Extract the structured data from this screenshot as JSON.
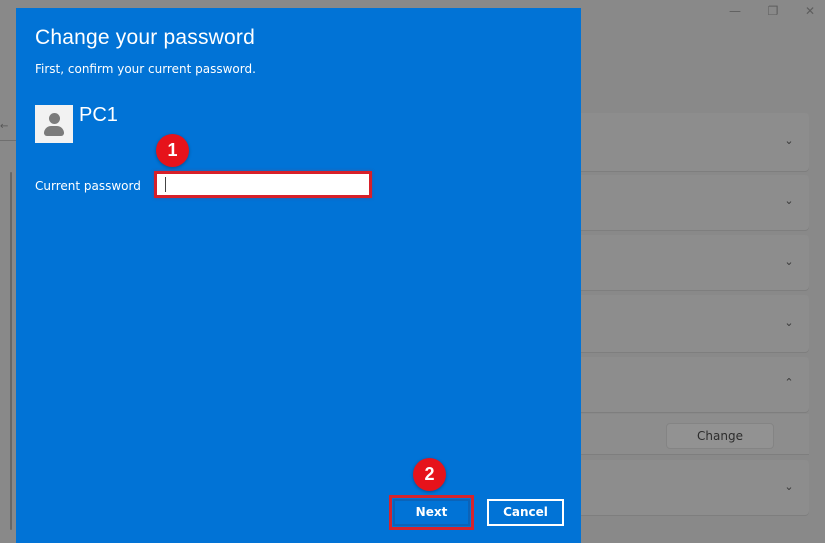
{
  "background_window": {
    "controls": {
      "minimize_icon": "—",
      "restore_icon": "❐",
      "close_icon": "✕"
    },
    "back_glyph": "←",
    "cards": [
      {
        "chevron": "down"
      },
      {
        "chevron": "down"
      },
      {
        "chevron": "down"
      },
      {
        "chevron": "down"
      },
      {
        "chevron": "up"
      },
      {
        "chevron": "down"
      }
    ],
    "change_button_label": "Change"
  },
  "dialog": {
    "title": "Change your password",
    "subtitle": "First, confirm your current password.",
    "account_name": "PC1",
    "current_password_label": "Current password",
    "current_password_value": "",
    "next_label": "Next",
    "cancel_label": "Cancel",
    "accent_color": "#0173d6"
  },
  "annotations": {
    "step1": "1",
    "step2": "2",
    "highlight_color": "#e6131b"
  }
}
